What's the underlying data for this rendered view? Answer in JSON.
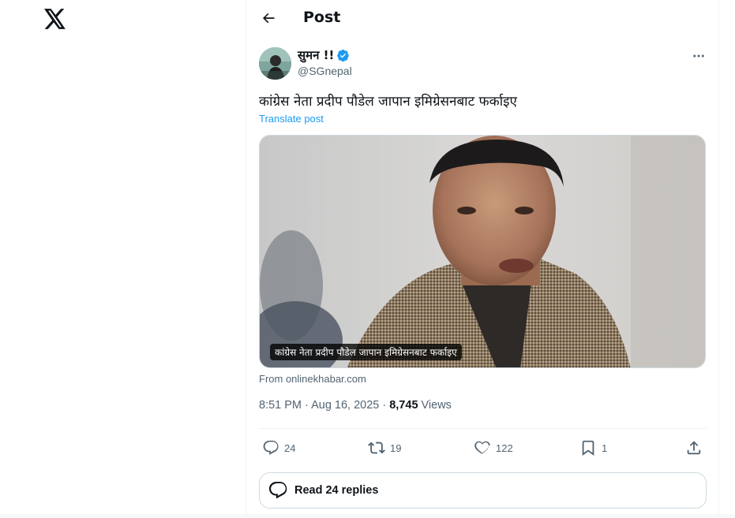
{
  "nav": {
    "back_label": "Back",
    "title": "Post"
  },
  "author": {
    "name": "सुमन !!",
    "handle": "@SGnepal",
    "verified_icon": "verified-badge-icon"
  },
  "tweet": {
    "text": "कांग्रेस नेता प्रदीप पौडेल जापान इमिग्रेसनबाट फर्काइए",
    "translate_label": "Translate post",
    "media_caption": "कांग्रेस नेता प्रदीप पौडेल जापान इमिग्रेसनबाट फर्काइए",
    "source": "From onlinekhabar.com",
    "time": "8:51 PM · Aug 16, 2025 ·",
    "views_count": "8,745",
    "views_label": "Views"
  },
  "actions": {
    "replies": "24",
    "reposts": "19",
    "likes": "122",
    "bookmarks": "1"
  },
  "read_replies_label": "Read 24 replies",
  "colors": {
    "accent": "#1d9bf0",
    "text": "#0f1419",
    "muted": "#536471",
    "border": "#eff3f4"
  }
}
